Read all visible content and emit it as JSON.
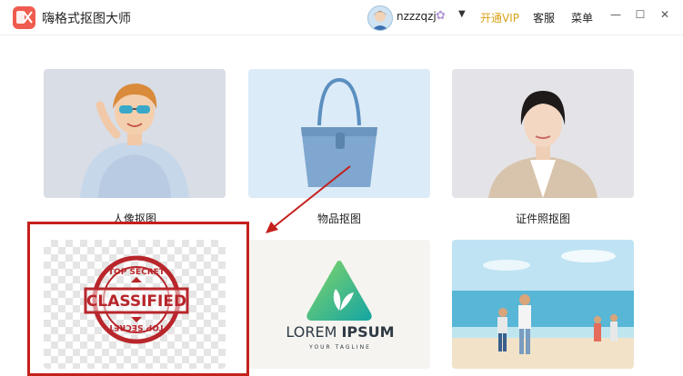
{
  "app": {
    "title": "嗨格式抠图大师",
    "logo_icon": "scissors-logo-icon"
  },
  "user": {
    "name": "nzzzqzj",
    "badge_icon": "flower-badge-icon",
    "dropdown_icon": "caret-down-icon"
  },
  "header_links": {
    "vip": "开通VIP",
    "service": "客服",
    "menu": "菜单"
  },
  "window_controls": {
    "minimize": "—",
    "maximize": "☐",
    "close": "✕"
  },
  "categories": [
    {
      "label": "人像抠图"
    },
    {
      "label": "物品抠图"
    },
    {
      "label": "证件照抠图"
    }
  ],
  "samples": {
    "stamp": {
      "top_text": "TOP SECRET",
      "center_text": "CLASSIFIED",
      "bottom_text": "TOP SECRET"
    },
    "logo": {
      "title_light": "LOREM",
      "title_bold": "IPSUM",
      "tagline": "YOUR TAGLINE"
    }
  },
  "colors": {
    "vip": "#d9a21a",
    "annotation": "#c4201c",
    "logo_green": "#3dbd87",
    "stamp_red": "#b8262b"
  }
}
